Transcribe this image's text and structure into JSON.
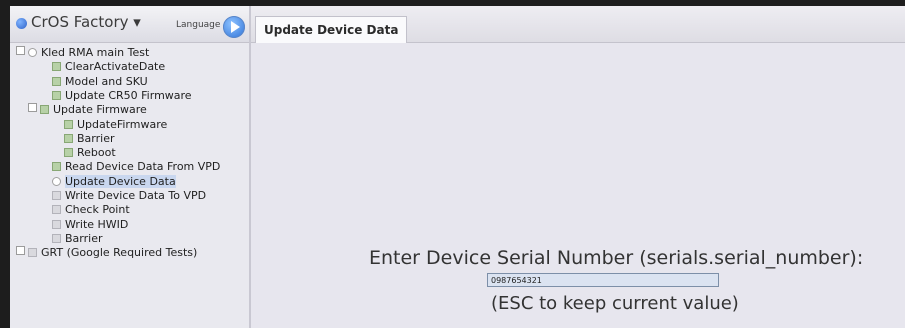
{
  "app": {
    "title": "CrOS Factory ▾",
    "language_label": "Language"
  },
  "tree": [
    {
      "label": "Kled RMA main Test",
      "status": "run",
      "expander": "⊟",
      "indent": 0
    },
    {
      "label": "ClearActivateDate",
      "status": "passed",
      "indent": 2
    },
    {
      "label": "Model and SKU",
      "status": "passed",
      "indent": 2
    },
    {
      "label": "Update CR50 Firmware",
      "status": "passed",
      "indent": 2
    },
    {
      "label": "Update Firmware",
      "status": "passed",
      "expander": "⊟",
      "indent": 1
    },
    {
      "label": "UpdateFirmware",
      "status": "passed",
      "indent": 3
    },
    {
      "label": "Barrier",
      "status": "passed",
      "indent": 3
    },
    {
      "label": "Reboot",
      "status": "passed",
      "indent": 3
    },
    {
      "label": "Read Device Data From VPD",
      "status": "passed",
      "indent": 2
    },
    {
      "label": "Update Device Data",
      "status": "run",
      "indent": 2,
      "selected": true
    },
    {
      "label": "Write Device Data To VPD",
      "status": "untested",
      "indent": 2
    },
    {
      "label": "Check Point",
      "status": "untested",
      "indent": 2
    },
    {
      "label": "Write HWID",
      "status": "untested",
      "indent": 2
    },
    {
      "label": "Barrier",
      "status": "untested",
      "indent": 2
    },
    {
      "label": "GRT (Google Required Tests)",
      "status": "untested",
      "expander": "⊞",
      "indent": 0
    }
  ],
  "tabs": [
    {
      "label": "Update Device Data",
      "active": true
    }
  ],
  "main": {
    "prompt": "Enter Device Serial Number (serials.serial_number):",
    "serial_value": "0987654321",
    "esc_hint": "(ESC to keep current value)"
  },
  "colors": {
    "passed": "#b7d1a7",
    "untested": "#d9d9de",
    "selected": "#c9d7ef",
    "accent": "#2a6fd6"
  }
}
